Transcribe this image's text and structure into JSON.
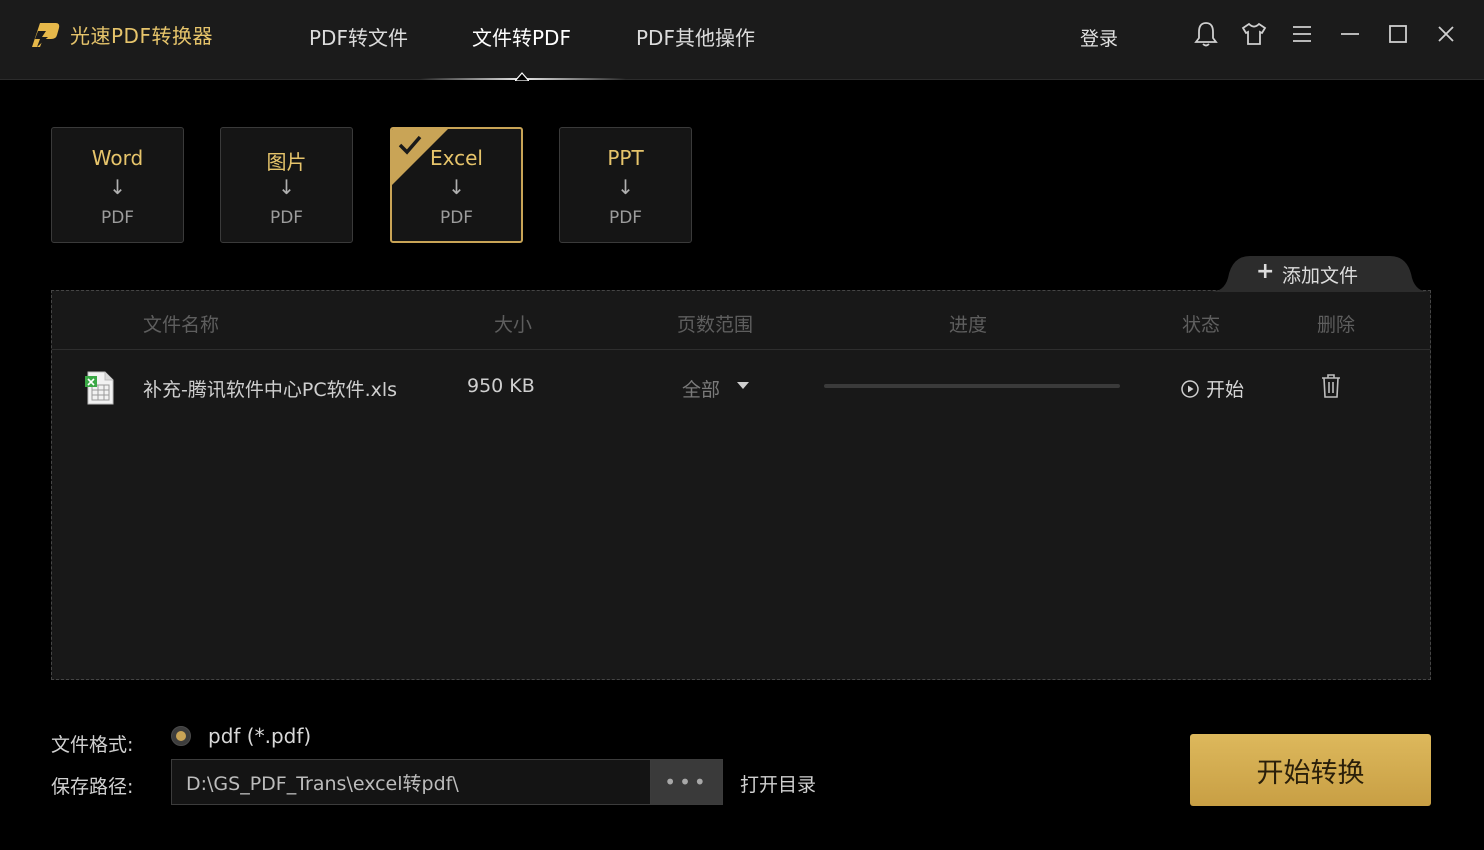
{
  "app": {
    "title": "光速PDF转换器",
    "accent": "#c9a456"
  },
  "nav": {
    "tabs": [
      {
        "label": "PDF转文件"
      },
      {
        "label": "文件转PDF"
      },
      {
        "label": "PDF其他操作"
      }
    ],
    "active_tab": "文件转PDF",
    "login_label": "登录"
  },
  "window_controls": [
    "bell-icon",
    "shirt-icon",
    "menu-icon",
    "minimize-icon",
    "maximize-icon",
    "close-icon"
  ],
  "conversion_types": [
    {
      "from": "Word",
      "to": "PDF"
    },
    {
      "from": "图片",
      "to": "PDF"
    },
    {
      "from": "Excel",
      "to": "PDF"
    },
    {
      "from": "PPT",
      "to": "PDF"
    }
  ],
  "selected_conversion": "Excel",
  "add_file": {
    "plus": "+",
    "label": "添加文件"
  },
  "table": {
    "headers": [
      "文件名称",
      "大小",
      "页数范围",
      "进度",
      "状态",
      "删除"
    ],
    "rows": [
      {
        "file_name": "补充-腾讯软件中心PC软件.xls",
        "size": "950 KB",
        "page_range": "全部",
        "progress": 0,
        "status": "开始"
      }
    ]
  },
  "bottom": {
    "format_label": "文件格式:",
    "format_option": "pdf (*.pdf)",
    "save_label": "保存路径:",
    "save_path": "D:\\GS_PDF_Trans\\excel转pdf\\",
    "browse_label": "•••",
    "open_dir_label": "打开目录",
    "start_button_label": "开始转换"
  }
}
